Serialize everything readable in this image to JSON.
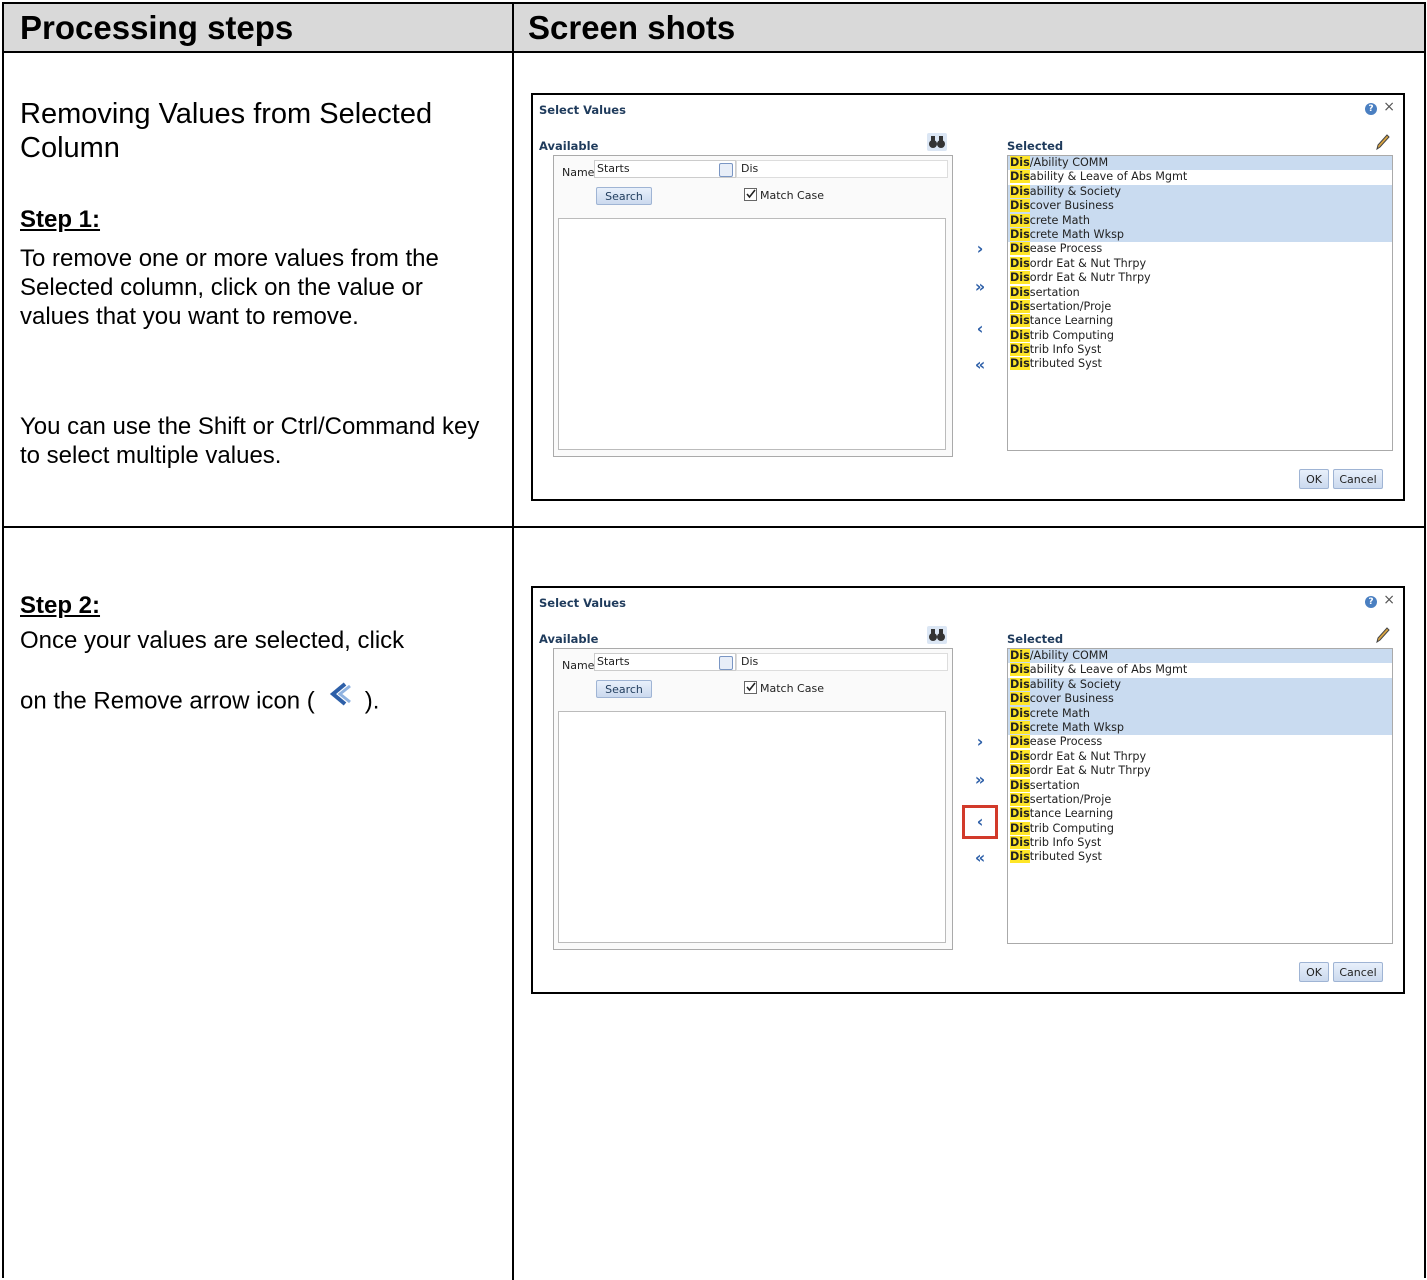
{
  "header": {
    "left": "Processing steps",
    "right": "Screen shots"
  },
  "section1": {
    "title": "Removing Values from Selected Column",
    "step_head": "Step 1:",
    "step_text": "To remove one or more values from the Selected column, click on the value or values that you want to remove.",
    "note_text": "You can use the Shift or Ctrl/Command key to select multiple values."
  },
  "section2": {
    "step_head": "Step 2:",
    "step_text_a": "Once your values are selected, click",
    "step_text_b": "on the Remove arrow icon (",
    "step_text_c": ").",
    "remove_icon": "remove-arrow-icon"
  },
  "dialog": {
    "title": "Select Values",
    "available_label": "Available",
    "selected_label": "Selected",
    "name_label": "Name",
    "name_select_value": "Starts",
    "search_value": "Dis",
    "search_button": "Search",
    "match_case_label": "Match Case",
    "match_case_checked": true,
    "ok_label": "OK",
    "cancel_label": "Cancel",
    "help_icon": "help-icon",
    "close_icon": "close-icon",
    "move_icons": [
      "move-right-icon",
      "move-all-right-icon",
      "remove-icon",
      "remove-all-icon"
    ],
    "highlight_color": "#ffe628",
    "selection_color": "#c9dbf0",
    "selected_items": [
      {
        "match": "Dis",
        "rest": "/Ability COMM",
        "selected": true
      },
      {
        "match": "Dis",
        "rest": "ability & Leave of Abs Mgmt",
        "selected": false
      },
      {
        "match": "Dis",
        "rest": "ability & Society",
        "selected": true
      },
      {
        "match": "Dis",
        "rest": "cover Business",
        "selected": true
      },
      {
        "match": "Dis",
        "rest": "crete Math",
        "selected": true
      },
      {
        "match": "Dis",
        "rest": "crete Math Wksp",
        "selected": true
      },
      {
        "match": "Dis",
        "rest": "ease Process",
        "selected": false
      },
      {
        "match": "Dis",
        "rest": "ordr Eat & Nut Thrpy",
        "selected": false
      },
      {
        "match": "Dis",
        "rest": "ordr Eat & Nutr Thrpy",
        "selected": false
      },
      {
        "match": "Dis",
        "rest": "sertation",
        "selected": false
      },
      {
        "match": "Dis",
        "rest": "sertation/Proje",
        "selected": false
      },
      {
        "match": "Dis",
        "rest": "tance Learning",
        "selected": false
      },
      {
        "match": "Dis",
        "rest": "trib Computing",
        "selected": false
      },
      {
        "match": "Dis",
        "rest": "trib Info Syst",
        "selected": false
      },
      {
        "match": "Dis",
        "rest": "tributed Syst",
        "selected": false
      }
    ]
  }
}
